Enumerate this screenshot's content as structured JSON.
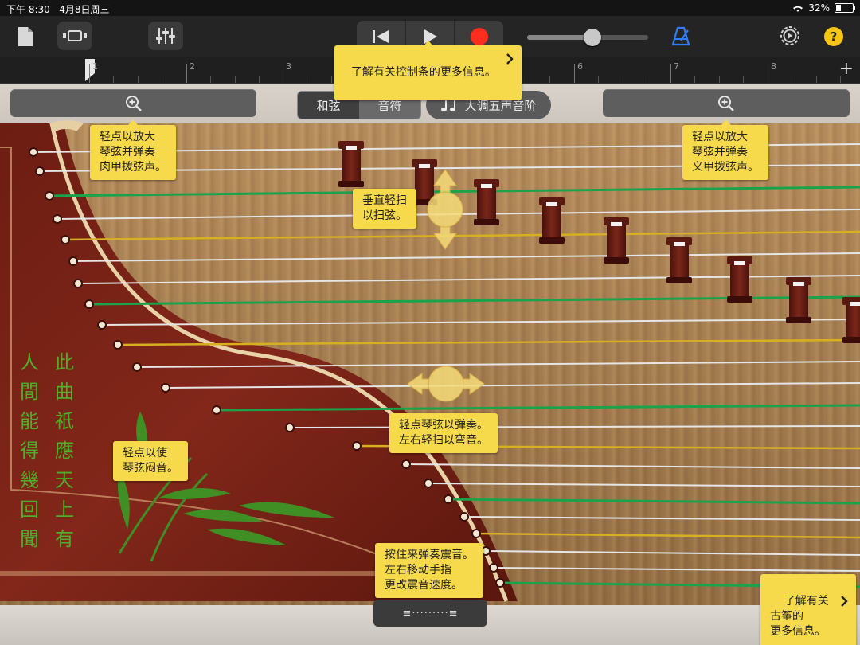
{
  "status_bar": {
    "time": "下午 8:30",
    "date": "4月8日周三",
    "battery": "32%"
  },
  "control_bar": {
    "icons": [
      "document-icon",
      "view-toggle-icon",
      "mixer-icon",
      "skip-back-icon",
      "play-icon",
      "record-icon",
      "metronome-icon",
      "settings-icon",
      "help-icon"
    ],
    "help_label": "?",
    "volume_level": 0.54,
    "accent_record": "#ff2d1e",
    "accent_metronome": "#2f7df6"
  },
  "ruler": {
    "marks": [
      "1",
      "2",
      "3",
      "4",
      "5",
      "6",
      "7",
      "8"
    ],
    "add_label": "+"
  },
  "tips": {
    "control_bar": "了解有关控制条的更多信息。",
    "zoom_left": "轻点以放大\n琴弦并弹奏\n肉甲拨弦声。",
    "zoom_right": "轻点以放大\n琴弦并弹奏\n义甲拨弦声。",
    "swipe_vertical": "垂直轻扫\n以扫弦。",
    "tap_string": "轻点琴弦以弹奏。\n左右轻扫以弯音。",
    "mute": "轻点以使\n琴弦闷音。",
    "vibrato": "按住来弹奏震音。\n左右移动手指\n更改震音速度。",
    "learn_more": "了解有关\n古筝的\n更多信息。"
  },
  "mode_segment": {
    "options": [
      "和弦",
      "音符"
    ],
    "selected": "和弦"
  },
  "scale_button": {
    "label": "大调五声音阶"
  },
  "poem": {
    "col1": "此曲祇應天上有",
    "col2": "人間能得幾回聞"
  },
  "vibrato_strip": {
    "label": "≡·········≡"
  },
  "colors": {
    "tooltip": "#f7d94c",
    "poem": "#4fae2a",
    "green_string": "#1aa34a",
    "gold_string": "#d6b020",
    "silver_string": "#e6e6e6"
  }
}
